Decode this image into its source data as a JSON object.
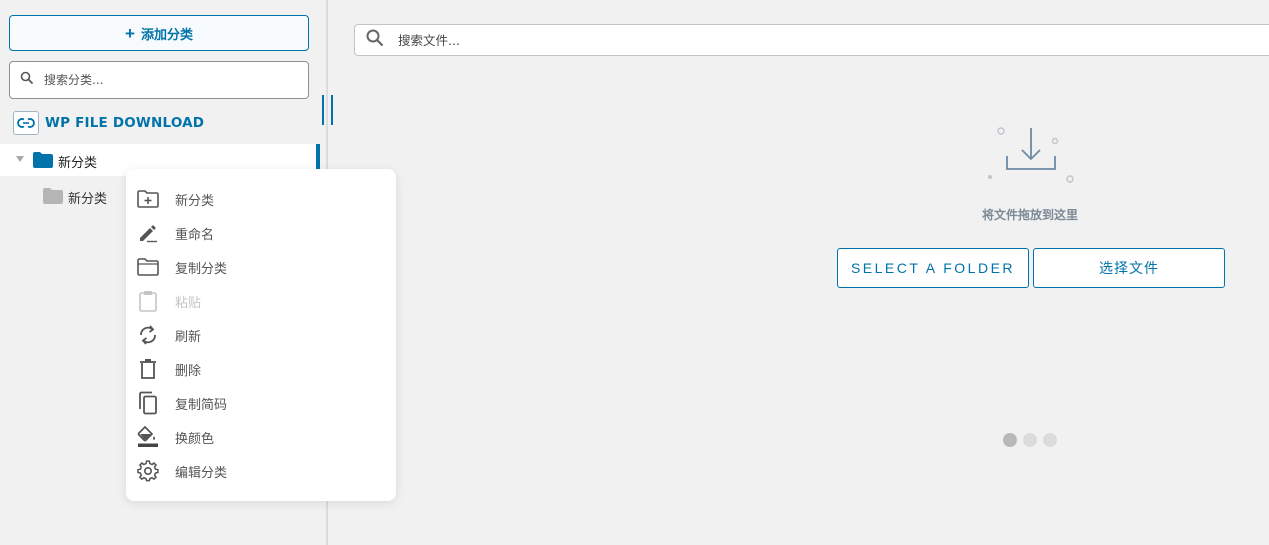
{
  "sidebar": {
    "add_category_label": "添加分类",
    "search_placeholder": "搜索分类...",
    "brand_name": "WP FILE DOWNLOAD",
    "tree": [
      {
        "label": "新分类",
        "expanded": true,
        "selected": true
      },
      {
        "label": "新分类",
        "expanded": false,
        "selected": false
      }
    ]
  },
  "context_menu": {
    "items": [
      {
        "label": "新分类",
        "icon": "folder-plus-icon",
        "disabled": false
      },
      {
        "label": "重命名",
        "icon": "pencil-icon",
        "disabled": false
      },
      {
        "label": "复制分类",
        "icon": "folder-outline-icon",
        "disabled": false
      },
      {
        "label": "粘贴",
        "icon": "clipboard-icon",
        "disabled": true
      },
      {
        "label": "刷新",
        "icon": "refresh-icon",
        "disabled": false
      },
      {
        "label": "删除",
        "icon": "trash-icon",
        "disabled": false
      },
      {
        "label": "复制简码",
        "icon": "copy-icon",
        "disabled": false
      },
      {
        "label": "换颜色",
        "icon": "paint-bucket-icon",
        "disabled": false
      },
      {
        "label": "编辑分类",
        "icon": "gear-icon",
        "disabled": false
      }
    ]
  },
  "main": {
    "search_placeholder": "搜索文件...",
    "drop_text": "将文件拖放到这里",
    "select_folder_label": "SELECT A FOLDER",
    "select_files_label": "选择文件"
  },
  "colors": {
    "accent": "#0073aa",
    "background": "#f1f1f1",
    "folder_active": "#0073aa",
    "folder_inactive": "#a7aaad"
  }
}
